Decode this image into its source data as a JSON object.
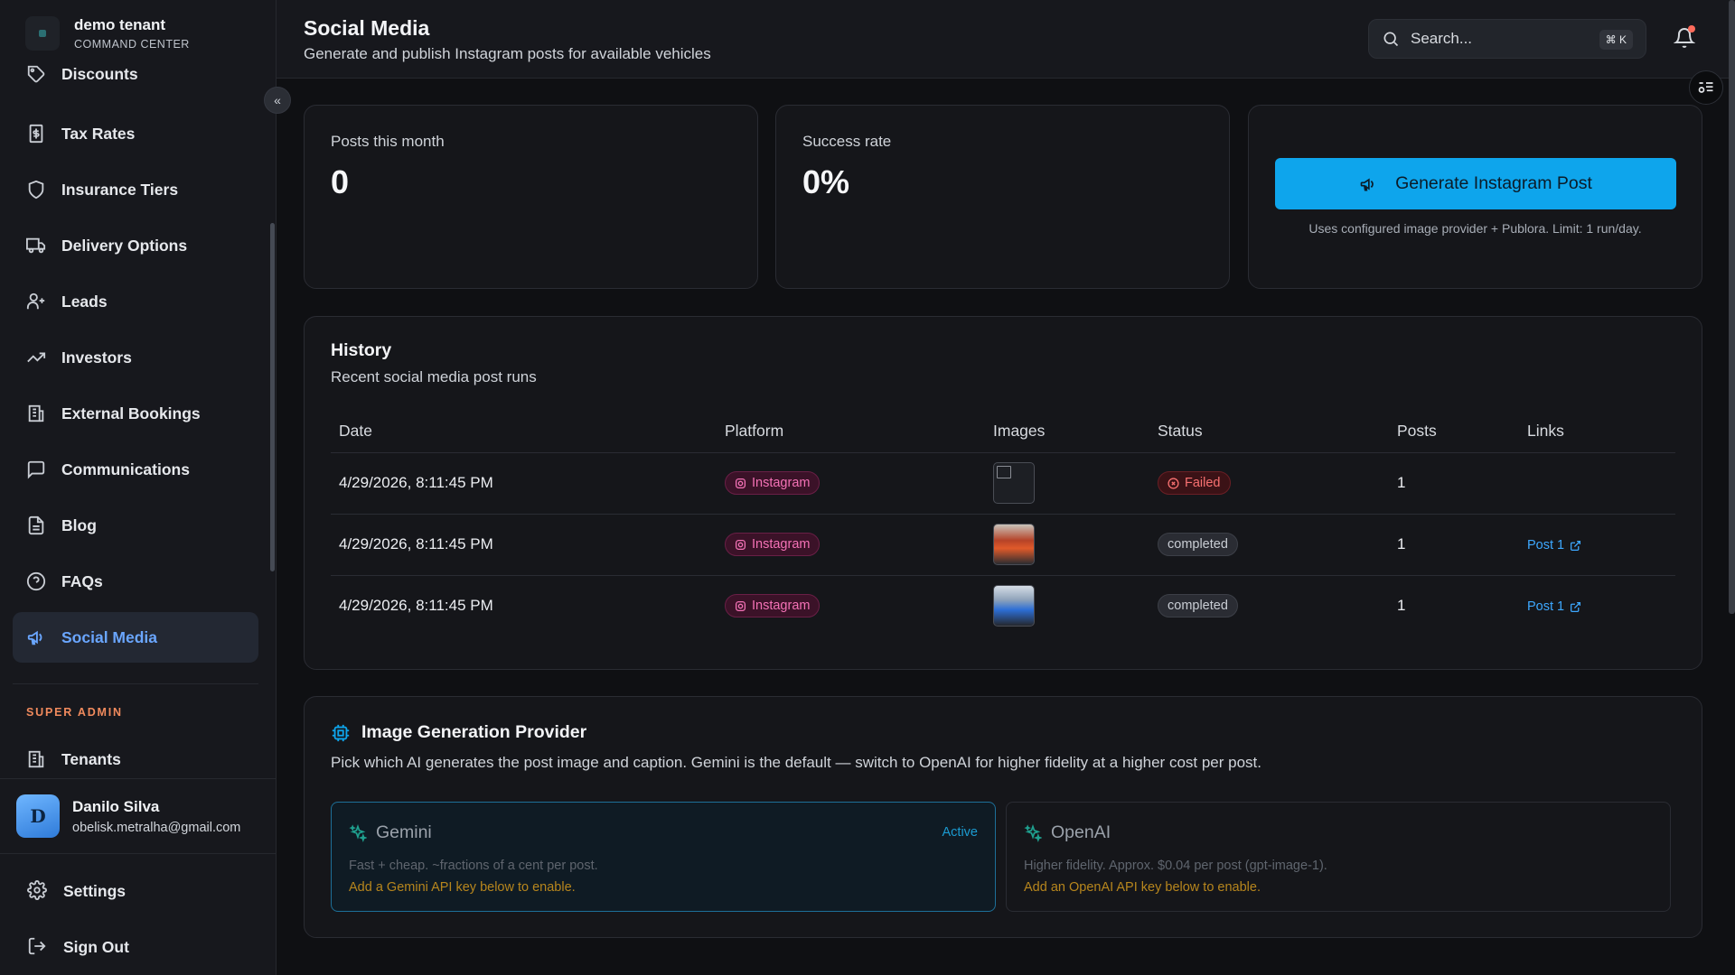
{
  "brand": {
    "name": "demo tenant",
    "subtitle": "COMMAND CENTER"
  },
  "sidebar": {
    "items": [
      {
        "label": "Discounts",
        "icon": "tag-icon"
      },
      {
        "label": "Tax Rates",
        "icon": "receipt-icon"
      },
      {
        "label": "Insurance Tiers",
        "icon": "shield-icon"
      },
      {
        "label": "Delivery Options",
        "icon": "truck-icon"
      },
      {
        "label": "Leads",
        "icon": "user-plus-icon"
      },
      {
        "label": "Investors",
        "icon": "trending-up-icon"
      },
      {
        "label": "External Bookings",
        "icon": "building-icon"
      },
      {
        "label": "Communications",
        "icon": "message-square-icon"
      },
      {
        "label": "Blog",
        "icon": "file-text-icon"
      },
      {
        "label": "FAQs",
        "icon": "help-circle-icon"
      },
      {
        "label": "Social Media",
        "icon": "megaphone-icon",
        "active": true
      }
    ],
    "super_admin_label": "SUPER ADMIN",
    "tenants_label": "Tenants",
    "user": {
      "initial": "D",
      "name": "Danilo Silva",
      "email": "obelisk.metralha@gmail.com"
    },
    "settings_label": "Settings",
    "signout_label": "Sign Out"
  },
  "header": {
    "title": "Social Media",
    "subtitle": "Generate and publish Instagram posts for available vehicles",
    "search_placeholder": "Search...",
    "search_shortcut": "⌘ K"
  },
  "stats": {
    "posts_label": "Posts this month",
    "posts_value": "0",
    "success_label": "Success rate",
    "success_value": "0%"
  },
  "generate": {
    "button_label": "Generate Instagram Post",
    "note": "Uses configured image provider + Publora. Limit: 1 run/day."
  },
  "history": {
    "title": "History",
    "subtitle": "Recent social media post runs",
    "columns": [
      "Date",
      "Platform",
      "Images",
      "Status",
      "Posts",
      "Links"
    ],
    "rows": [
      {
        "date": "4/29/2026, 8:11:45 PM",
        "platform": "Instagram",
        "status": "Failed",
        "posts": "1",
        "link": ""
      },
      {
        "date": "4/29/2026, 8:11:45 PM",
        "platform": "Instagram",
        "status": "completed",
        "posts": "1",
        "link": "Post 1"
      },
      {
        "date": "4/29/2026, 8:11:45 PM",
        "platform": "Instagram",
        "status": "completed",
        "posts": "1",
        "link": "Post 1"
      }
    ]
  },
  "provider": {
    "title": "Image Generation Provider",
    "subtitle": "Pick which AI generates the post image and caption. Gemini is the default — switch to OpenAI for higher fidelity at a higher cost per post.",
    "options": [
      {
        "name": "Gemini",
        "status": "Active",
        "desc": "Fast + cheap. ~fractions of a cent per post.",
        "warn": "Add a Gemini API key below to enable."
      },
      {
        "name": "OpenAI",
        "status": "",
        "desc": "Higher fidelity. Approx. $0.04 per post (gpt-image-1).",
        "warn": "Add an OpenAI API key below to enable."
      }
    ]
  },
  "colors": {
    "accent": "#0ea5ec",
    "active_nav": "#6aa6ff",
    "instagram": "#f472b6",
    "failed": "#f87171",
    "warning": "#b7861d"
  }
}
